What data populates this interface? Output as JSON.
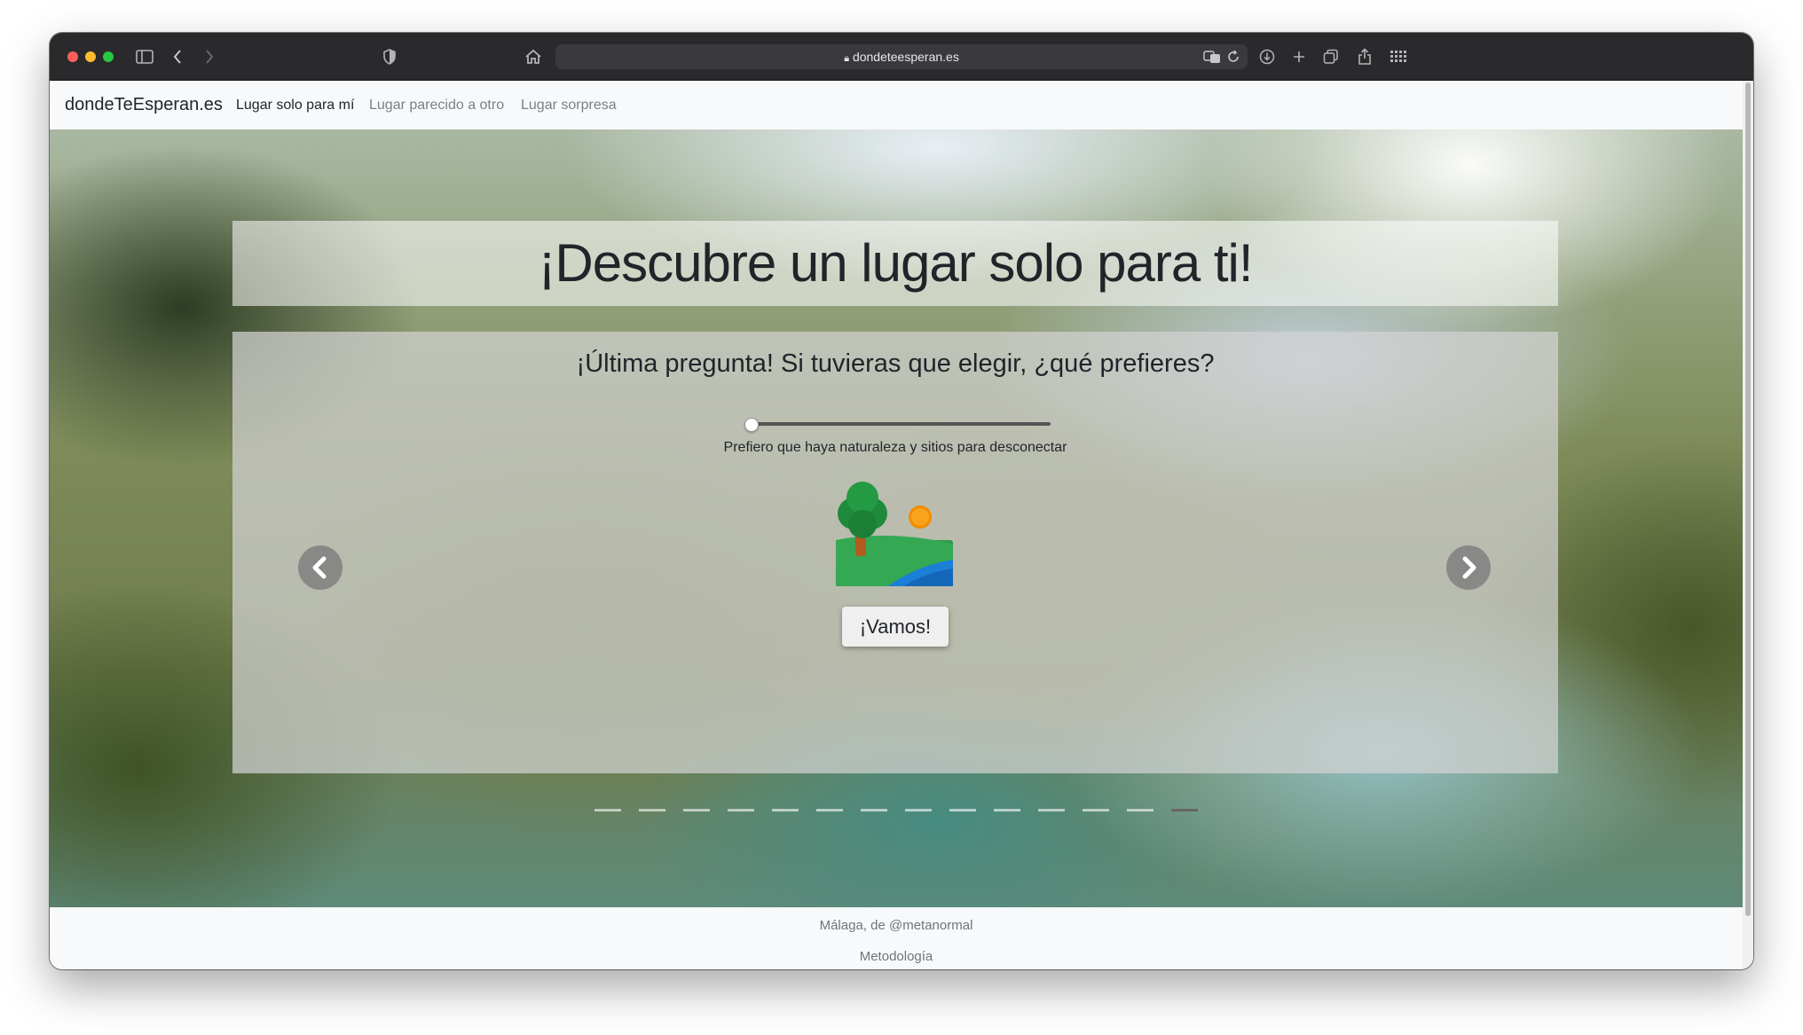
{
  "browser": {
    "url": "dondeteesperan.es",
    "traffic_lights": [
      "#ff5f57",
      "#febc2e",
      "#28c840"
    ]
  },
  "navbar": {
    "brand": "dondeTeEsperan.es",
    "links": [
      {
        "label": "Lugar solo para mí",
        "active": true
      },
      {
        "label": "Lugar parecido a otro",
        "active": false
      },
      {
        "label": "Lugar sorpresa",
        "active": false
      }
    ]
  },
  "hero": {
    "title": "¡Descubre un lugar solo para ti!"
  },
  "card": {
    "question": "¡Última pregunta! Si tuvieras que elegir, ¿qué prefieres?",
    "slider_caption": "Prefiero que haya naturaleza y sitios para desconectar",
    "slider_value": 0,
    "illustration": "nature-landscape-icon",
    "button_label": "¡Vamos!",
    "indicators_total": 14,
    "indicators_active": 14
  },
  "footer": {
    "credit": "Málaga, de @metanormal",
    "methodology": "Metodología"
  }
}
